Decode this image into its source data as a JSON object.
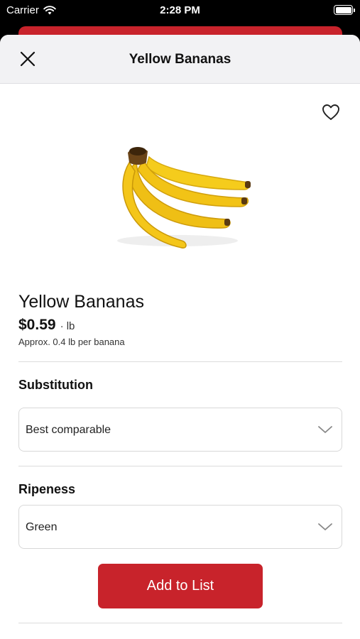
{
  "status_bar": {
    "carrier": "Carrier",
    "time": "2:28 PM",
    "wifi_icon": "wifi-icon",
    "battery_icon": "battery-icon"
  },
  "header": {
    "title": "Yellow Bananas",
    "close_icon": "close-icon"
  },
  "product": {
    "favorite_icon": "heart-outline-icon",
    "image": "yellow-bananas-photo",
    "name": "Yellow Bananas",
    "price": "$0.59",
    "unit": "· lb",
    "approx": "Approx. 0.4 lb per banana"
  },
  "substitution": {
    "label": "Substitution",
    "value": "Best comparable",
    "chevron_icon": "chevron-down-icon"
  },
  "ripeness": {
    "label": "Ripeness",
    "value": "Green",
    "chevron_icon": "chevron-down-icon"
  },
  "actions": {
    "add_to_list": "Add to List"
  },
  "colors": {
    "brand_red": "#c8232b",
    "banana_yellow": "#f2c316"
  }
}
